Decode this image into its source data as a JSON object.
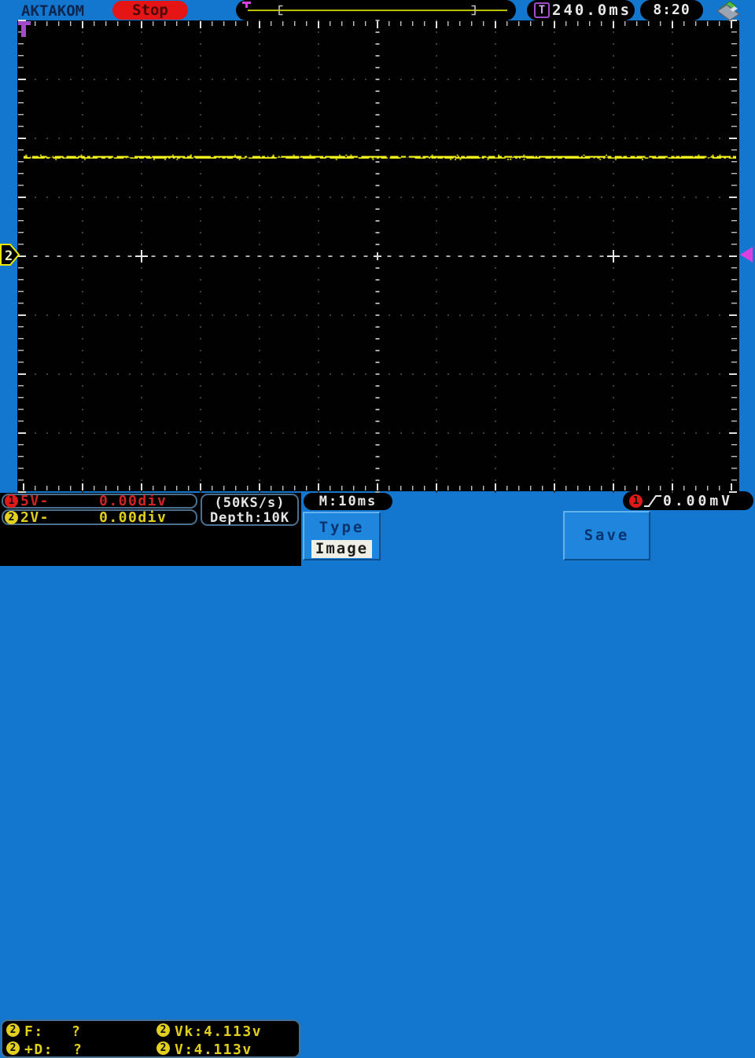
{
  "brand": "AKTAKOM",
  "top_bar": {
    "run_state": "Stop",
    "trigger_icon": "T",
    "trigger_time": "240.0ms",
    "clock": "8:20"
  },
  "channels": {
    "ch1": {
      "id": "1",
      "scale": "5V-",
      "position": "0.00div",
      "color": "#e01818"
    },
    "ch2": {
      "id": "2",
      "scale": "2V-",
      "position": "0.00div",
      "color": "#e8e800"
    }
  },
  "acquisition": {
    "sample_rate": "(50KS/s)",
    "depth": "Depth:10K",
    "timebase": "M:10ms"
  },
  "trigger_readout": {
    "channel": "1",
    "edge": "rising",
    "level": "0.00mV"
  },
  "measurements": {
    "channel": "2",
    "rows": [
      {
        "left_label": "F:",
        "left_value": "?",
        "right_text": "Vk:4.113v"
      },
      {
        "left_label": "+D:",
        "left_value": "?",
        "right_text": "V:4.113v"
      }
    ]
  },
  "menu": {
    "type_label": "Type",
    "type_value": "Image",
    "save_label": "Save"
  },
  "markers": {
    "ch2_left": "2"
  },
  "colors": {
    "background_blue": "#1377d0",
    "ch1_red": "#e01818",
    "ch2_yellow": "#e8e800",
    "trigger_purple": "#a04cc8",
    "marker_magenta": "#d840e0",
    "stop_red": "#e51515"
  },
  "chart_data": {
    "type": "line",
    "series": [
      {
        "name": "CH2",
        "color": "#e8e800",
        "shape": "flat-dc-noisy",
        "value_volts": 4.113,
        "volts_per_div": 2,
        "offset_div": 0.0
      }
    ],
    "timebase_per_div": "10ms",
    "grid_divisions": "12x8",
    "trigger_level_mv": 0.0
  }
}
